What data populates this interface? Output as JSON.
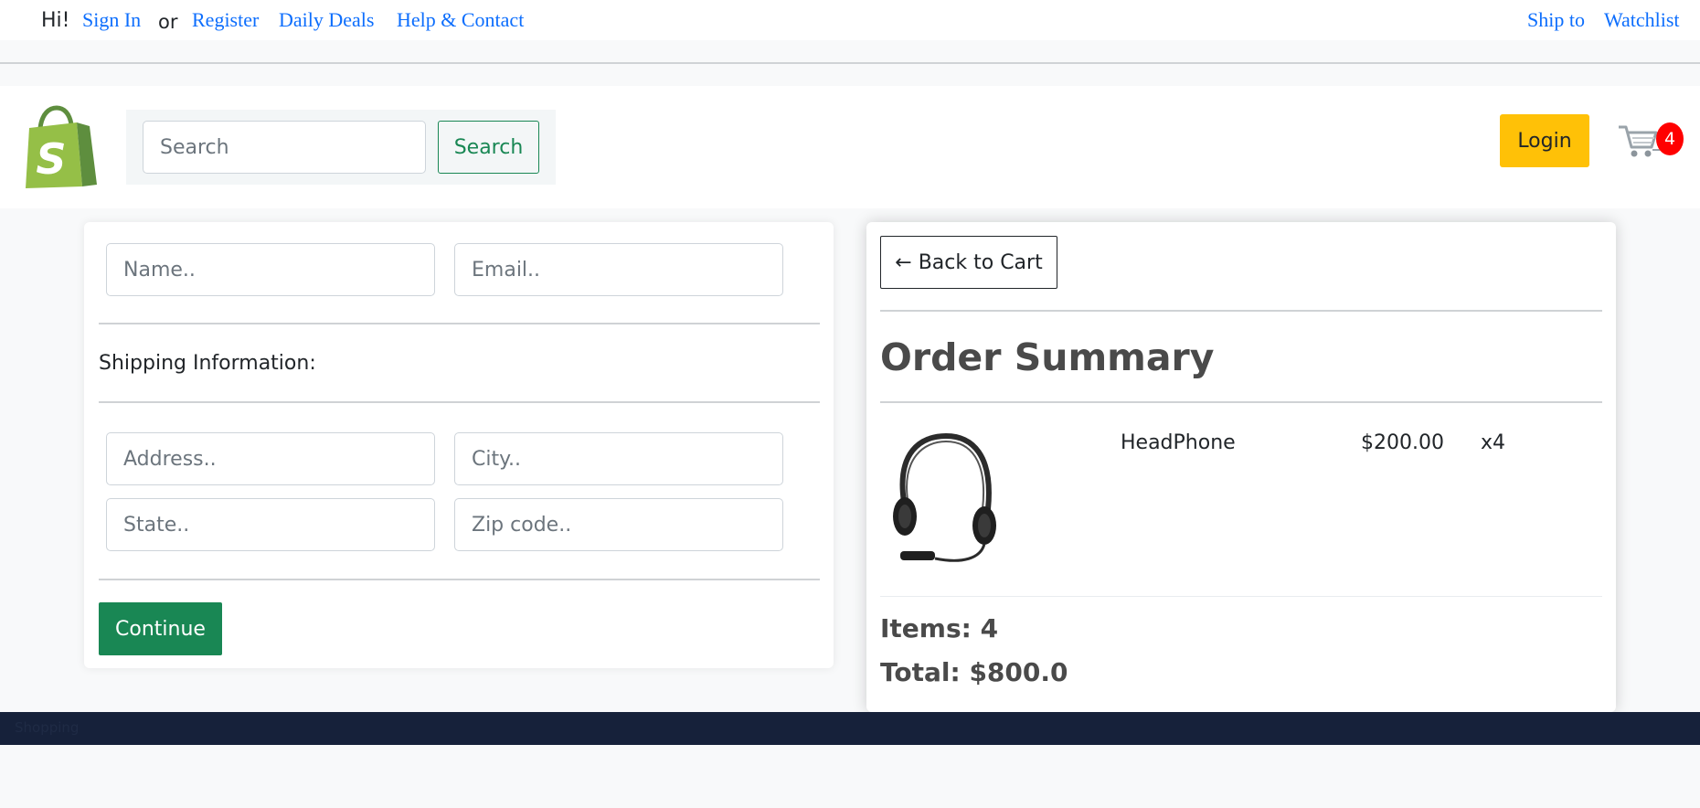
{
  "topbar": {
    "greeting": "Hi!",
    "sign_in": "Sign In",
    "or": "or",
    "register": "Register",
    "daily_deals": "Daily Deals",
    "help_contact": "Help & Contact",
    "ship_to": "Ship to",
    "watchlist": "Watchlist"
  },
  "header": {
    "search_placeholder": "Search",
    "search_button": "Search",
    "login_button": "Login",
    "cart_count": "4"
  },
  "checkout_form": {
    "name_placeholder": "Name..",
    "email_placeholder": "Email..",
    "shipping_label": "Shipping Information:",
    "address_placeholder": "Address..",
    "city_placeholder": "City..",
    "state_placeholder": "State..",
    "zip_placeholder": "Zip code..",
    "continue_button": "Continue"
  },
  "order_summary": {
    "back_button": "← Back to Cart",
    "title": "Order Summary",
    "items": [
      {
        "name": "HeadPhone",
        "price": "$200.00",
        "quantity": "x4"
      }
    ],
    "items_count": "Items: 4",
    "total": "Total: $800.0"
  },
  "footer": {
    "text": "Shopping"
  },
  "colors": {
    "link": "#0d6efd",
    "success": "#198754",
    "warning": "#ffc107",
    "badge": "#ff0000",
    "footer_bg": "#16213a"
  },
  "icons": {
    "logo": "shopify-bag-icon",
    "cart": "shopping-cart-icon"
  }
}
